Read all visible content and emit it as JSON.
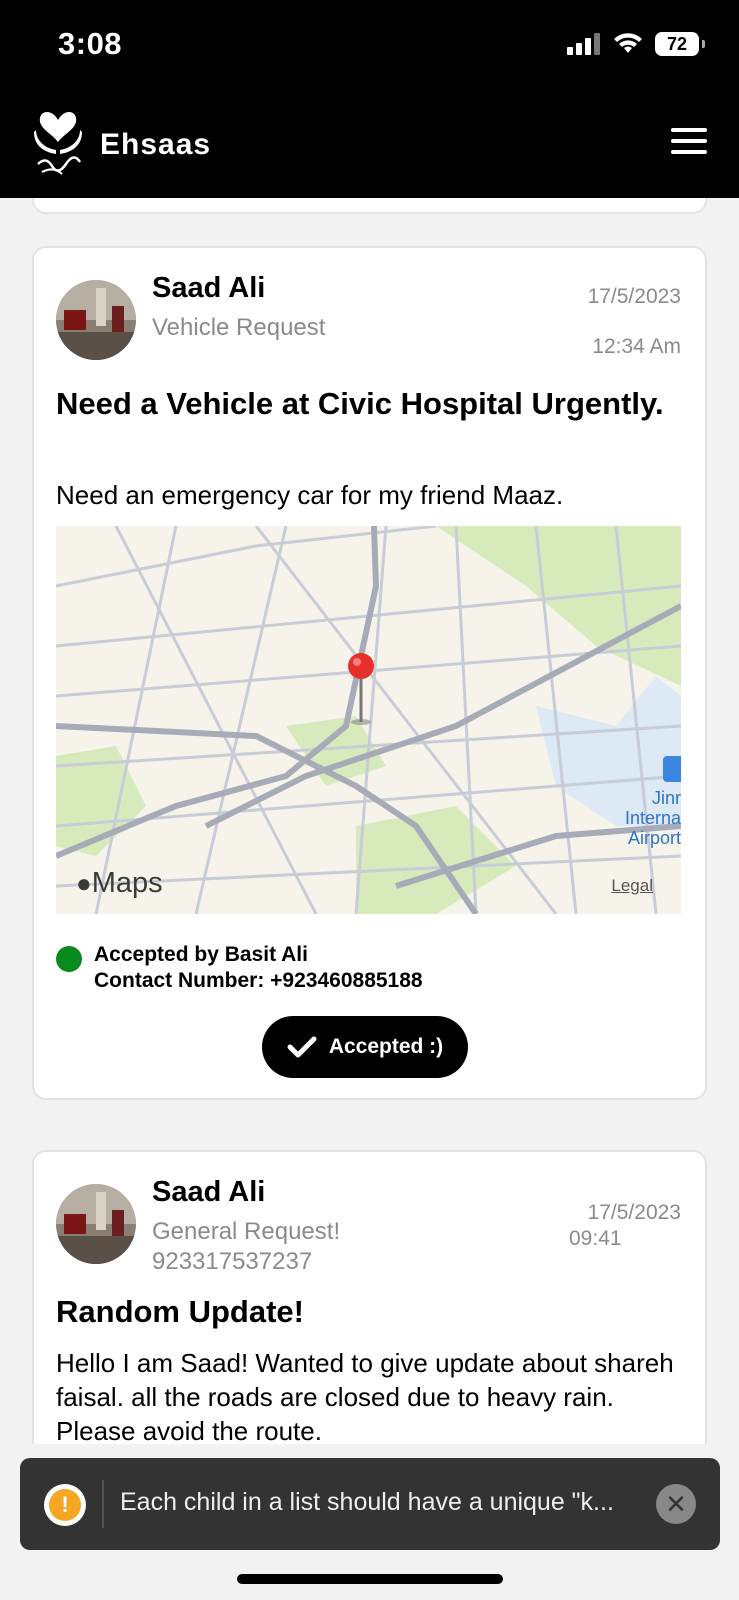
{
  "status_bar": {
    "time": "3:08",
    "battery": "72"
  },
  "header": {
    "title": "Ehsaas",
    "logo_name": "ehsaas-logo",
    "menu_icon": "hamburger-icon"
  },
  "posts": [
    {
      "name": "Saad Ali",
      "type": "Vehicle Request",
      "date": "17/5/2023",
      "time": "12:34 Am",
      "title": "Need a Vehicle at Civic Hospital Urgently.",
      "body": "Need an emergency car for my friend Maaz.",
      "map": {
        "brand": "Maps",
        "legal": "Legal",
        "label": "Jinnah International Airport",
        "label_lines": [
          "Jinr",
          "Interna",
          "Airport"
        ]
      },
      "accepted_by": "Accepted by Basit Ali",
      "contact": "Contact Number: +923460885188",
      "button_label": "Accepted :)",
      "status_color": "#0a8a1c"
    },
    {
      "name": "Saad Ali",
      "type": "General Request!",
      "phone": "923317537237",
      "date": "17/5/2023",
      "time": "09:41",
      "title": "Random Update!",
      "body": "Hello I am Saad! Wanted to give update about shareh faisal. all the roads are closed due to heavy rain. Please avoid the route."
    }
  ],
  "toast": {
    "message": "Each child in a list should have a unique \"k...",
    "icon": "warning-icon",
    "close_icon": "close-icon"
  }
}
